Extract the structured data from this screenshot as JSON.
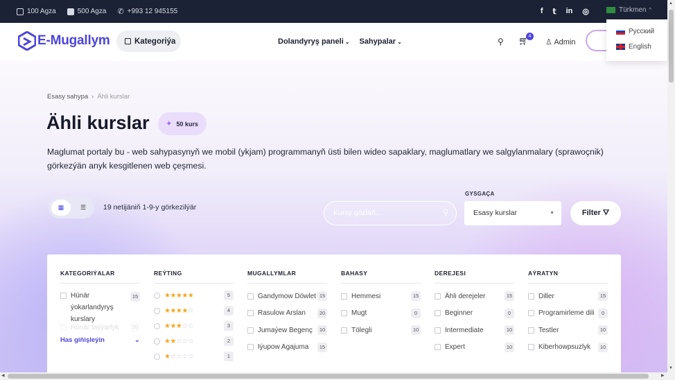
{
  "topbar": {
    "students": "100 Agza",
    "facebook": "500 Agza",
    "phone": "+993 12 945155",
    "language": "Türkmen"
  },
  "language_menu": [
    "Русский",
    "English"
  ],
  "header": {
    "logo": "E-Mugallym",
    "category_button": "Kategoriýa",
    "nav": [
      "Dolandyryş paneli",
      "Sahypalar"
    ],
    "cart_count": "4",
    "user": "Admin"
  },
  "breadcrumb": {
    "home": "Esasy sahypa",
    "current": "Ähli kurslar"
  },
  "page": {
    "title": "Ähli kurslar",
    "course_count": "50 kurs",
    "description": "Maglumat portaly bu - web sahypasynyň we mobil (ykjam) programmanyň üsti bilen wideo sapaklary, maglumatlary we salgylanmalary (sprawoçnik) görkezýän anyk kesgitlenen web çeşmesi.",
    "results_text": "19 netijäniň 1-9-y görkezilýär"
  },
  "search": {
    "placeholder": "Kursy gözläň..."
  },
  "sort": {
    "label": "GYSGAÇA",
    "selected": "Esasy kurslar"
  },
  "filter_button": "Filter",
  "filters": {
    "categories": {
      "title": "KATEGORIÝALAR",
      "items": [
        {
          "label": "Hünär ýokarlandyryş kurslary",
          "count": "15"
        },
        {
          "label": "Hünär taýýarlyk",
          "count": "20"
        }
      ],
      "more": "Has giňişleýin"
    },
    "rating": {
      "title": "REÝTING",
      "items": [
        {
          "stars": 5,
          "count": "5"
        },
        {
          "stars": 4,
          "count": "4"
        },
        {
          "stars": 3,
          "count": "3"
        },
        {
          "stars": 2,
          "count": "2"
        },
        {
          "stars": 1,
          "count": "1"
        }
      ]
    },
    "teachers": {
      "title": "MUGALLYMLAR",
      "items": [
        {
          "label": "Gandymow Döwlet",
          "count": "15"
        },
        {
          "label": "Rasulow Arslan",
          "count": "20"
        },
        {
          "label": "Jumaýew Begenç",
          "count": "10"
        },
        {
          "label": "Iýupow Agajuma",
          "count": "15"
        }
      ]
    },
    "price": {
      "title": "BAHASY",
      "items": [
        {
          "label": "Hemmesi",
          "count": "15"
        },
        {
          "label": "Mugt",
          "count": "0"
        },
        {
          "label": "Tölegli",
          "count": "10"
        }
      ]
    },
    "level": {
      "title": "DEREJESI",
      "items": [
        {
          "label": "Ähli derejeler",
          "count": "15"
        },
        {
          "label": "Beginner",
          "count": "0"
        },
        {
          "label": "Intermediate",
          "count": "10"
        },
        {
          "label": "Expert",
          "count": "10"
        }
      ]
    },
    "other": {
      "title": "AÝRATYN",
      "items": [
        {
          "label": "Diller",
          "count": "15"
        },
        {
          "label": "Programirleme dili",
          "count": "0"
        },
        {
          "label": "Testler",
          "count": "10"
        },
        {
          "label": "Kiberhowpsuzlyk",
          "count": "10"
        }
      ]
    }
  },
  "colors": {
    "accent": "#4d45d8",
    "topbar": "#1b2235"
  }
}
